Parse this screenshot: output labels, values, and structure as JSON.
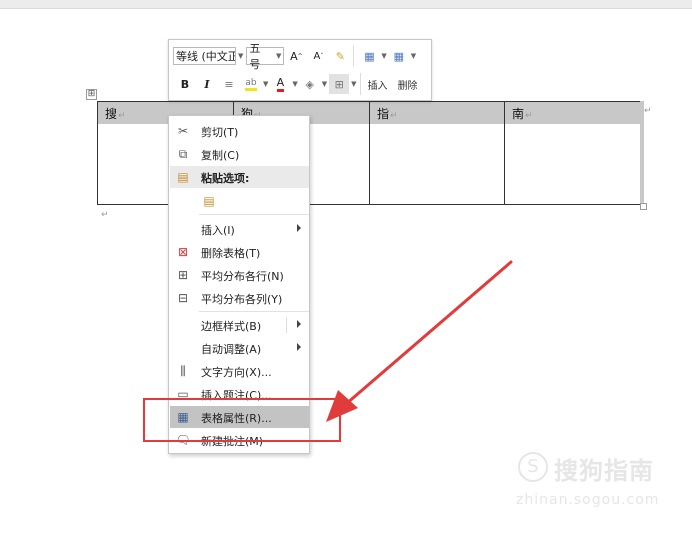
{
  "table": {
    "headers": [
      "搜",
      "狗",
      "指",
      "南"
    ],
    "para_mark": "↵",
    "move_handle": "⊞"
  },
  "mini_toolbar": {
    "font_name": "等线 (中文正",
    "font_size": "五号",
    "grow_font": "A",
    "shrink_font": "A",
    "bold": "B",
    "italic": "I",
    "insert_label": "插入",
    "delete_label": "删除"
  },
  "context_menu": {
    "items": [
      {
        "label": "剪切(T)",
        "icon": "scissors-icon"
      },
      {
        "label": "复制(C)",
        "icon": "copy-icon"
      },
      {
        "label": "粘贴选项:",
        "icon": "paste-icon"
      },
      {
        "label": "插入(I)",
        "icon": "",
        "submenu": true
      },
      {
        "label": "删除表格(T)",
        "icon": "delete-table-icon"
      },
      {
        "label": "平均分布各行(N)",
        "icon": "distribute-rows-icon"
      },
      {
        "label": "平均分布各列(Y)",
        "icon": "distribute-columns-icon"
      },
      {
        "label": "边框样式(B)",
        "icon": "",
        "submenu": true
      },
      {
        "label": "自动调整(A)",
        "icon": "",
        "submenu": true
      },
      {
        "label": "文字方向(X)...",
        "icon": "text-direction-icon"
      },
      {
        "label": "插入题注(C)...",
        "icon": "insert-caption-icon"
      },
      {
        "label": "表格属性(R)...",
        "icon": "table-properties-icon",
        "highlighted": true
      },
      {
        "label": "新建批注(M)",
        "icon": "new-comment-icon"
      }
    ]
  },
  "annotation": {
    "box_color": "#e23b3b",
    "arrow_color": "#e23b3b"
  },
  "watermark": {
    "name": "搜狗指南",
    "url": "zhinan.sogou.com"
  }
}
